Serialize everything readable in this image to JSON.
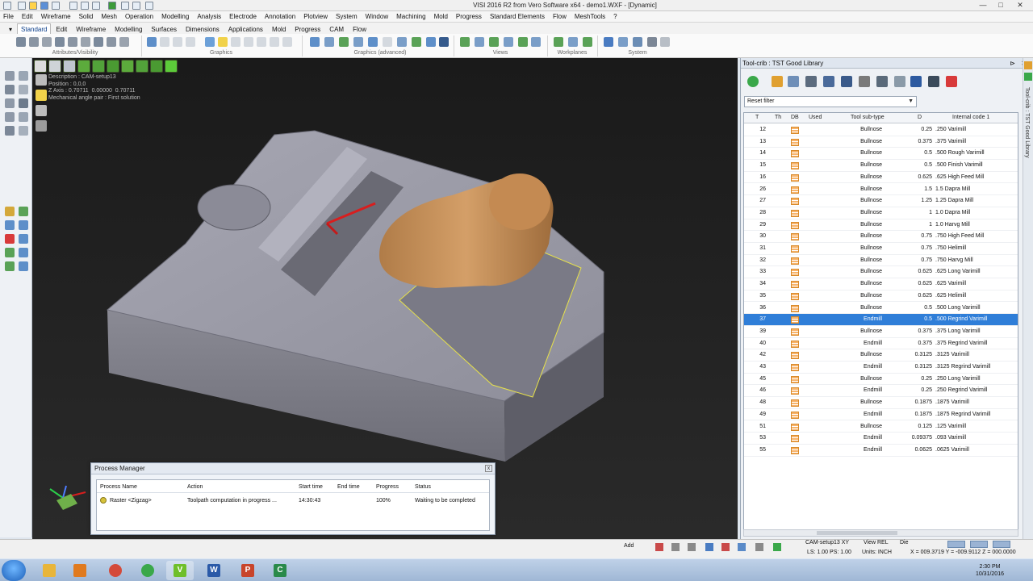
{
  "window": {
    "title": "VISI 2016 R2 from Vero Software x64 - demo1.WXF - [Dynamic]",
    "controls": [
      "—",
      "□",
      "✕"
    ]
  },
  "menu": [
    "File",
    "Edit",
    "Wireframe",
    "Solid",
    "Mesh",
    "Operation",
    "Modelling",
    "Analysis",
    "Electrode",
    "Annotation",
    "Plotview",
    "System",
    "Window",
    "Machining",
    "Mold",
    "Progress",
    "Standard Elements",
    "Flow",
    "MeshTools",
    "?"
  ],
  "ribbon": {
    "tabs": [
      "Standard",
      "Edit",
      "Wireframe",
      "Modelling",
      "Surfaces",
      "Dimensions",
      "Applications",
      "Mold",
      "Progress",
      "CAM",
      "Flow"
    ],
    "active_tab": "Standard",
    "groups": [
      "Attributes/Visibility",
      "Graphics",
      "Graphics (advanced)",
      "Views",
      "Workplanes",
      "System"
    ]
  },
  "viewport": {
    "info": {
      "line1": "Description : CAM-setup13",
      "line2": "Position : 0,0,0",
      "line3": "Z Axis : 0.70711  0.00000  0.70711",
      "line4": "Mechanical angle pair : First solution"
    }
  },
  "process_manager": {
    "title": "Process Manager",
    "columns": [
      "Process Name",
      "Action",
      "Start time",
      "End time",
      "Progress",
      "Status"
    ],
    "rows": [
      {
        "name": "Raster <Zigzag>",
        "action": "Toolpath computation in progress ...",
        "start": "14:30:43",
        "end": "",
        "progress": "100%",
        "status": "Waiting to be completed"
      }
    ]
  },
  "tool_crib": {
    "title": "Tool-crib : TST Good Library",
    "side_label": "Tool-crib : TST Good Library",
    "filter": "Reset filter",
    "columns": [
      "T",
      "Th",
      "DB",
      "Used",
      "Tool sub-type",
      "D",
      "Internal code 1"
    ],
    "rows": [
      {
        "t": "12",
        "sub": "Bullnose",
        "d": "0.25",
        "code": ".250 Varimill"
      },
      {
        "t": "13",
        "sub": "Bullnose",
        "d": "0.375",
        "code": ".375 Varimill"
      },
      {
        "t": "14",
        "sub": "Bullnose",
        "d": "0.5",
        "code": ".500 Rough Varimill"
      },
      {
        "t": "15",
        "sub": "Bullnose",
        "d": "0.5",
        "code": ".500 Finish Varimill"
      },
      {
        "t": "16",
        "sub": "Bullnose",
        "d": "0.625",
        "code": ".625 High Feed Mill"
      },
      {
        "t": "26",
        "sub": "Bullnose",
        "d": "1.5",
        "code": "1.5 Dapra Mill"
      },
      {
        "t": "27",
        "sub": "Bullnose",
        "d": "1.25",
        "code": "1.25 Dapra Mill"
      },
      {
        "t": "28",
        "sub": "Bullnose",
        "d": "1",
        "code": "1.0 Dapra Mill"
      },
      {
        "t": "29",
        "sub": "Bullnose",
        "d": "1",
        "code": "1.0 Harvg Mill"
      },
      {
        "t": "30",
        "sub": "Bullnose",
        "d": "0.75",
        "code": ".750 High Feed Mill"
      },
      {
        "t": "31",
        "sub": "Bullnose",
        "d": "0.75",
        "code": ".750 Helimill"
      },
      {
        "t": "32",
        "sub": "Bullnose",
        "d": "0.75",
        "code": ".750 Harvg Mill"
      },
      {
        "t": "33",
        "sub": "Bullnose",
        "d": "0.625",
        "code": ".625 Long Varimill"
      },
      {
        "t": "34",
        "sub": "Bullnose",
        "d": "0.625",
        "code": ".625 Varimill"
      },
      {
        "t": "35",
        "sub": "Bullnose",
        "d": "0.625",
        "code": ".625 Helimill"
      },
      {
        "t": "36",
        "sub": "Bullnose",
        "d": "0.5",
        "code": ".500 Long Varimill"
      },
      {
        "t": "37",
        "sub": "Endmill",
        "d": "0.5",
        "code": ".500 Regrind Varimill"
      },
      {
        "t": "39",
        "sub": "Bullnose",
        "d": "0.375",
        "code": ".375 Long Varimill"
      },
      {
        "t": "40",
        "sub": "Endmill",
        "d": "0.375",
        "code": ".375 Regrind Varimill"
      },
      {
        "t": "42",
        "sub": "Bullnose",
        "d": "0.3125",
        "code": ".3125 Varimill"
      },
      {
        "t": "43",
        "sub": "Endmill",
        "d": "0.3125",
        "code": ".3125 Regrind Varimill"
      },
      {
        "t": "45",
        "sub": "Bullnose",
        "d": "0.25",
        "code": ".250 Long Varimill"
      },
      {
        "t": "46",
        "sub": "Endmill",
        "d": "0.25",
        "code": ".250 Regrind Varimill"
      },
      {
        "t": "48",
        "sub": "Bullnose",
        "d": "0.1875",
        "code": ".1875 Varimill"
      },
      {
        "t": "49",
        "sub": "Endmill",
        "d": "0.1875",
        "code": ".1875 Regrind Varimill"
      },
      {
        "t": "51",
        "sub": "Bullnose",
        "d": "0.125",
        "code": ".125 Varimill"
      },
      {
        "t": "53",
        "sub": "Endmill",
        "d": "0.09375",
        "code": ".093 Varimill"
      },
      {
        "t": "55",
        "sub": "Endmill",
        "d": "0.0625",
        "code": ".0625 Varimill"
      }
    ],
    "selected_row": "37"
  },
  "status_bar": {
    "add_label": "Add",
    "setup": "CAM-setup13 XY",
    "view": "View REL",
    "die": "Die",
    "ls": "LS: 1.00 PS: 1.00",
    "units": "Units: INCH",
    "coords": "X = 009.3719 Y = -009.9112 Z = 000.0000"
  },
  "taskbar": {
    "apps": [
      "Explorer",
      "Media",
      "Chrome",
      "Chrome",
      "VISI",
      "Word",
      "PowerPoint",
      "Camtasia"
    ],
    "time": "2:30 PM",
    "date": "10/31/2016"
  },
  "colors": {
    "selection": "#2f7ed8",
    "tool_body": "#c6925c",
    "model_gray": "#7c7c86",
    "toolpath_yellow": "#e8e24a"
  }
}
